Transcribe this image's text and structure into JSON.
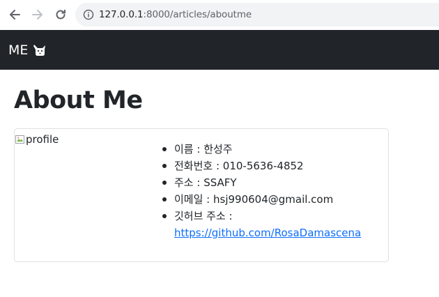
{
  "browser": {
    "url_host": "127.0.0.1",
    "url_path": ":8000/articles/aboutme"
  },
  "navbar": {
    "brand_text": "ME",
    "brand_icon": "cat-face-icon",
    "bg_color": "#212529"
  },
  "page": {
    "title": "About Me"
  },
  "profile": {
    "image_alt": "profile",
    "items": [
      {
        "label": "이름",
        "separator": " : ",
        "value": "한성주"
      },
      {
        "label": "전화번호",
        "separator": " : ",
        "value": "010-5636-4852"
      },
      {
        "label": "주소",
        "separator": " : ",
        "value": "SSAFY"
      },
      {
        "label": "이메일",
        "separator": " : ",
        "value": "hsj990604@gmail.com"
      }
    ],
    "github": {
      "label": "깃허브 주소",
      "separator": " : ",
      "link_text": "https://github.com/RosaDamascena",
      "link_color": "#0d6efd"
    }
  }
}
